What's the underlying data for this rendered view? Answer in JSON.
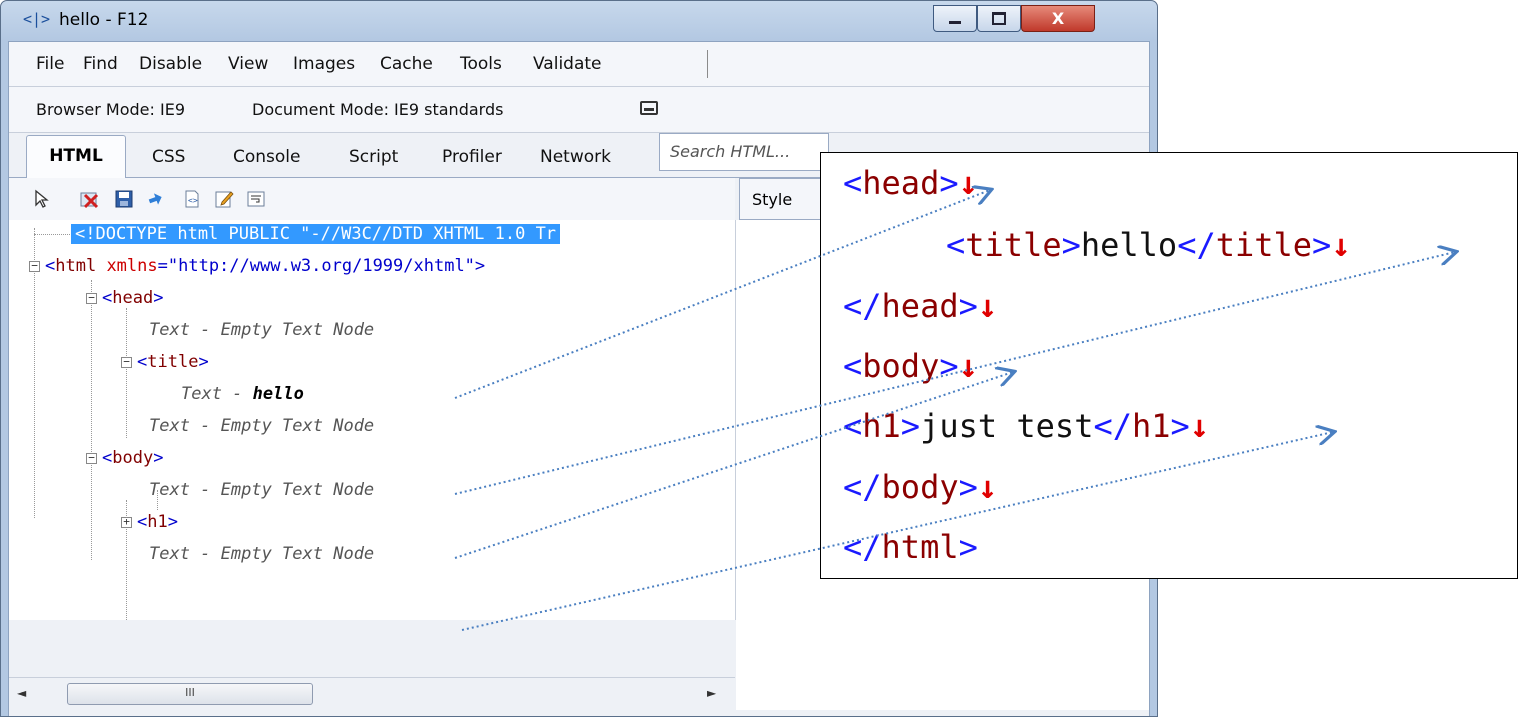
{
  "window": {
    "title": "hello - F12",
    "app_icon": "<|>",
    "controls": {
      "minimize": "",
      "maximize": "",
      "close": "X"
    }
  },
  "menu": {
    "items": [
      "File",
      "Find",
      "Disable",
      "View",
      "Images",
      "Cache",
      "Tools",
      "Validate"
    ]
  },
  "mode_bar": {
    "browser_mode": "Browser Mode: IE9",
    "document_mode": "Document Mode: IE9 standards"
  },
  "tabs": {
    "items": [
      "HTML",
      "CSS",
      "Console",
      "Script",
      "Profiler",
      "Network"
    ],
    "active": "HTML"
  },
  "search": {
    "placeholder": "Search HTML..."
  },
  "toolbar": {
    "icons": [
      "select-element-icon",
      "clear-browser-cache-icon",
      "save-icon",
      "refresh-icon",
      "view-source-icon",
      "edit-icon",
      "word-wrap-icon"
    ]
  },
  "side_tab": {
    "label": "Style"
  },
  "tree": {
    "doctype": "<!DOCTYPE html PUBLIC \"-//W3C//DTD XHTML 1.0 Tr",
    "html_open": "<",
    "html_tag": "html",
    "html_attr": " xmlns",
    "html_eq": "=",
    "html_val": "\"http://www.w3.org/1999/xhtml\"",
    "html_close": ">",
    "head_lt": "<",
    "head_tag": "head",
    "head_gt": ">",
    "text1": "Text - Empty Text Node",
    "title_lt": "<",
    "title_tag": "title",
    "title_gt": ">",
    "text_hello_prefix": "Text - ",
    "text_hello": "hello",
    "text2": "Text - Empty Text Node",
    "body_lt": "<",
    "body_tag": "body",
    "body_gt": ">",
    "text3": "Text - Empty Text Node",
    "h1_lt": "<",
    "h1_tag": "h1",
    "h1_gt": ">",
    "text4": "Text - Empty Text Node",
    "expand": "+",
    "collapse": "−"
  },
  "hscroll": {
    "left": "◄",
    "right": "►",
    "thumb": "III"
  },
  "callout": {
    "lines": [
      {
        "lt": "<",
        "tag": "head",
        "gt": ">",
        "ret": "↓"
      },
      {
        "lt": "<",
        "tag": "title",
        "gt": ">",
        "text": "hello",
        "lt2": "</",
        "tag2": "title",
        "gt2": ">",
        "ret": "↓"
      },
      {
        "lt": "</",
        "tag": "head",
        "gt": ">",
        "ret": "↓"
      },
      {
        "lt": "<",
        "tag": "body",
        "gt": ">",
        "ret": "↓"
      },
      {
        "lt": "<",
        "tag": "h1",
        "gt": ">",
        "text": "just test",
        "lt2": "</",
        "tag2": "h1",
        "gt2": ">",
        "ret": "↓"
      },
      {
        "lt": "</",
        "tag": "body",
        "gt": ">",
        "ret": "↓"
      },
      {
        "lt": "</",
        "tag": "html",
        "gt": ">"
      }
    ]
  },
  "colors": {
    "angle": "#1a1aff",
    "tag": "#8b0000",
    "return_arrow": "#e00000",
    "arrow_line": "#4a7fc1",
    "selection": "#3399ff"
  }
}
